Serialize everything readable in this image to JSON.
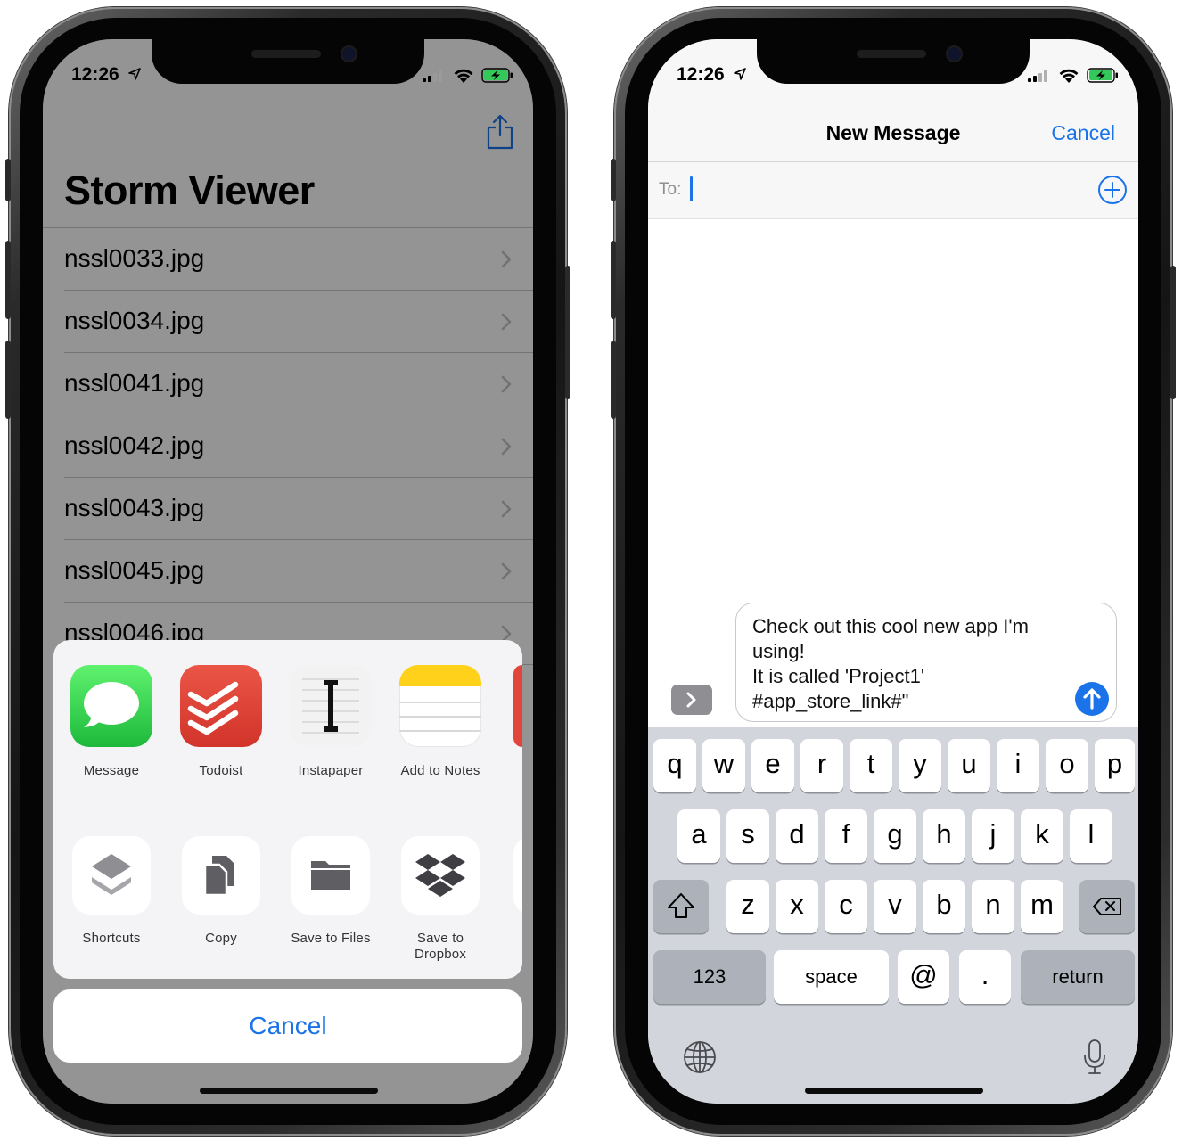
{
  "status": {
    "time": "12:26"
  },
  "left": {
    "title": "Storm Viewer",
    "files": [
      "nssl0033.jpg",
      "nssl0034.jpg",
      "nssl0041.jpg",
      "nssl0042.jpg",
      "nssl0043.jpg",
      "nssl0045.jpg",
      "nssl0046.jpg"
    ],
    "share_apps": [
      {
        "label": "Message",
        "icon": "messages-icon"
      },
      {
        "label": "Todoist",
        "icon": "todoist-icon"
      },
      {
        "label": "Instapaper",
        "icon": "instapaper-icon"
      },
      {
        "label": "Add to Notes",
        "icon": "notes-icon"
      }
    ],
    "share_actions": [
      {
        "label": "Shortcuts",
        "icon": "shortcuts-icon"
      },
      {
        "label": "Copy",
        "icon": "copy-icon"
      },
      {
        "label": "Save to Files",
        "icon": "folder-icon"
      },
      {
        "label": "Save to\nDropbox",
        "icon": "dropbox-icon"
      }
    ],
    "cancel": "Cancel"
  },
  "right": {
    "nav_title": "New Message",
    "nav_cancel": "Cancel",
    "to_label": "To:",
    "message_lines": [
      "Check out this cool new app I'm",
      "using!",
      "It is called 'Project1'",
      "#app_store_link#\""
    ],
    "keyboard": {
      "row1": [
        "q",
        "w",
        "e",
        "r",
        "t",
        "y",
        "u",
        "i",
        "o",
        "p"
      ],
      "row2": [
        "a",
        "s",
        "d",
        "f",
        "g",
        "h",
        "j",
        "k",
        "l"
      ],
      "row3": [
        "z",
        "x",
        "c",
        "v",
        "b",
        "n",
        "m"
      ],
      "numbers": "123",
      "space": "space",
      "at": "@",
      "dot": ".",
      "return": "return"
    }
  },
  "colors": {
    "accent": "#1a73e8",
    "messages": "#2fc24f",
    "todoist": "#e2453c",
    "notes_yellow": "#ffcc00"
  }
}
